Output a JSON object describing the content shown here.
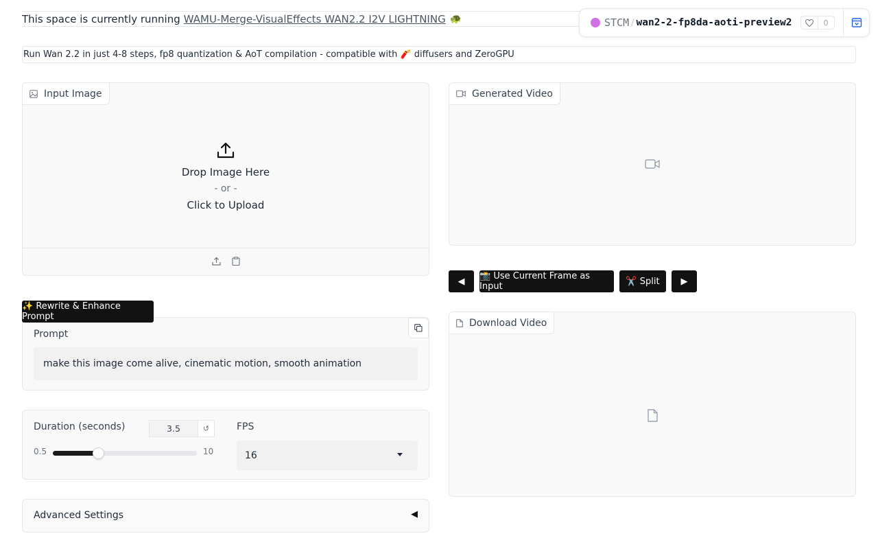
{
  "running_bar": {
    "prefix": "This space is currently running",
    "link": "WAMU-Merge-VisualEffects WAN2.2 I2V LIGHTNING",
    "emoji": "🐢"
  },
  "space_header": {
    "owner": "STCM",
    "separator": "/",
    "repo": "wan2-2-fp8da-aoti-preview2",
    "likes": "0",
    "accent_color": "#d070e6"
  },
  "description": "Run Wan 2.2 in just 4-8 steps, fp8 quantization & AoT compilation - compatible with 🧨 diffusers and ZeroGPU",
  "input_image": {
    "label": "Input Image",
    "drop_text": "Drop Image Here",
    "or_text": "- or -",
    "click_text": "Click to Upload"
  },
  "generated_video": {
    "label": "Generated Video"
  },
  "frame_controls": {
    "prev": "◀",
    "use_frame": "📸 Use Current Frame as Input",
    "split": "✂️ Split",
    "next": "▶"
  },
  "rewrite_button": "✨ Rewrite & Enhance Prompt",
  "prompt": {
    "label": "Prompt",
    "value": "make this image come alive, cinematic motion, smooth animation"
  },
  "download_video": {
    "label": "Download Video"
  },
  "duration": {
    "label": "Duration (seconds)",
    "value": "3.5",
    "reset": "↺",
    "min": "0.5",
    "max": "10",
    "fraction": 0.3158
  },
  "fps": {
    "label": "FPS",
    "selected": "16"
  },
  "advanced": {
    "label": "Advanced Settings",
    "arrow": "◀"
  }
}
